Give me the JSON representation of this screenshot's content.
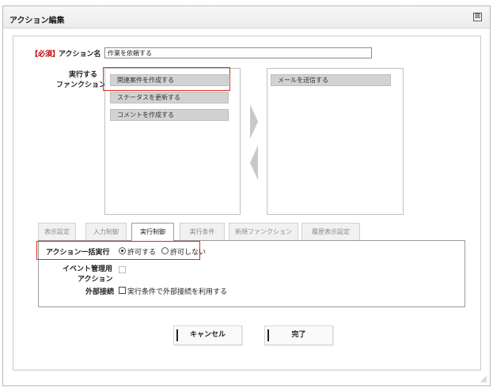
{
  "window": {
    "title": "アクション編集",
    "close_symbol": "⊠"
  },
  "form": {
    "required_label": "【必須】",
    "action_name_label": "アクション名",
    "action_name_value": "作業を依頼する",
    "functions_label_line1": "実行する",
    "functions_label_line2": "ファンクション",
    "available_functions": [
      "関連案件を作成する",
      "ステータスを更新する",
      "コメントを作成する"
    ],
    "selected_functions": [
      "メールを送信する"
    ]
  },
  "tabs": [
    "表示設定",
    "入力制御",
    "実行制御",
    "実行条件",
    "新規ファンクション",
    "履歴表示設定"
  ],
  "active_tab": "実行制御",
  "execution": {
    "bulk_label": "アクション一括実行",
    "allow_label": "許可する",
    "deny_label": "許可しない",
    "bulk_selected": "許可する",
    "event_label_line1": "イベント管理用",
    "event_label_line2": "アクション",
    "external_label": "外部接続",
    "external_checkbox_label": "実行条件で外部接続を利用する"
  },
  "buttons": {
    "cancel": "キャンセル",
    "done": "完了"
  },
  "colors": {
    "highlight": "#e0281e",
    "required": "#c00000",
    "item_bg": "#d2d2d2"
  }
}
